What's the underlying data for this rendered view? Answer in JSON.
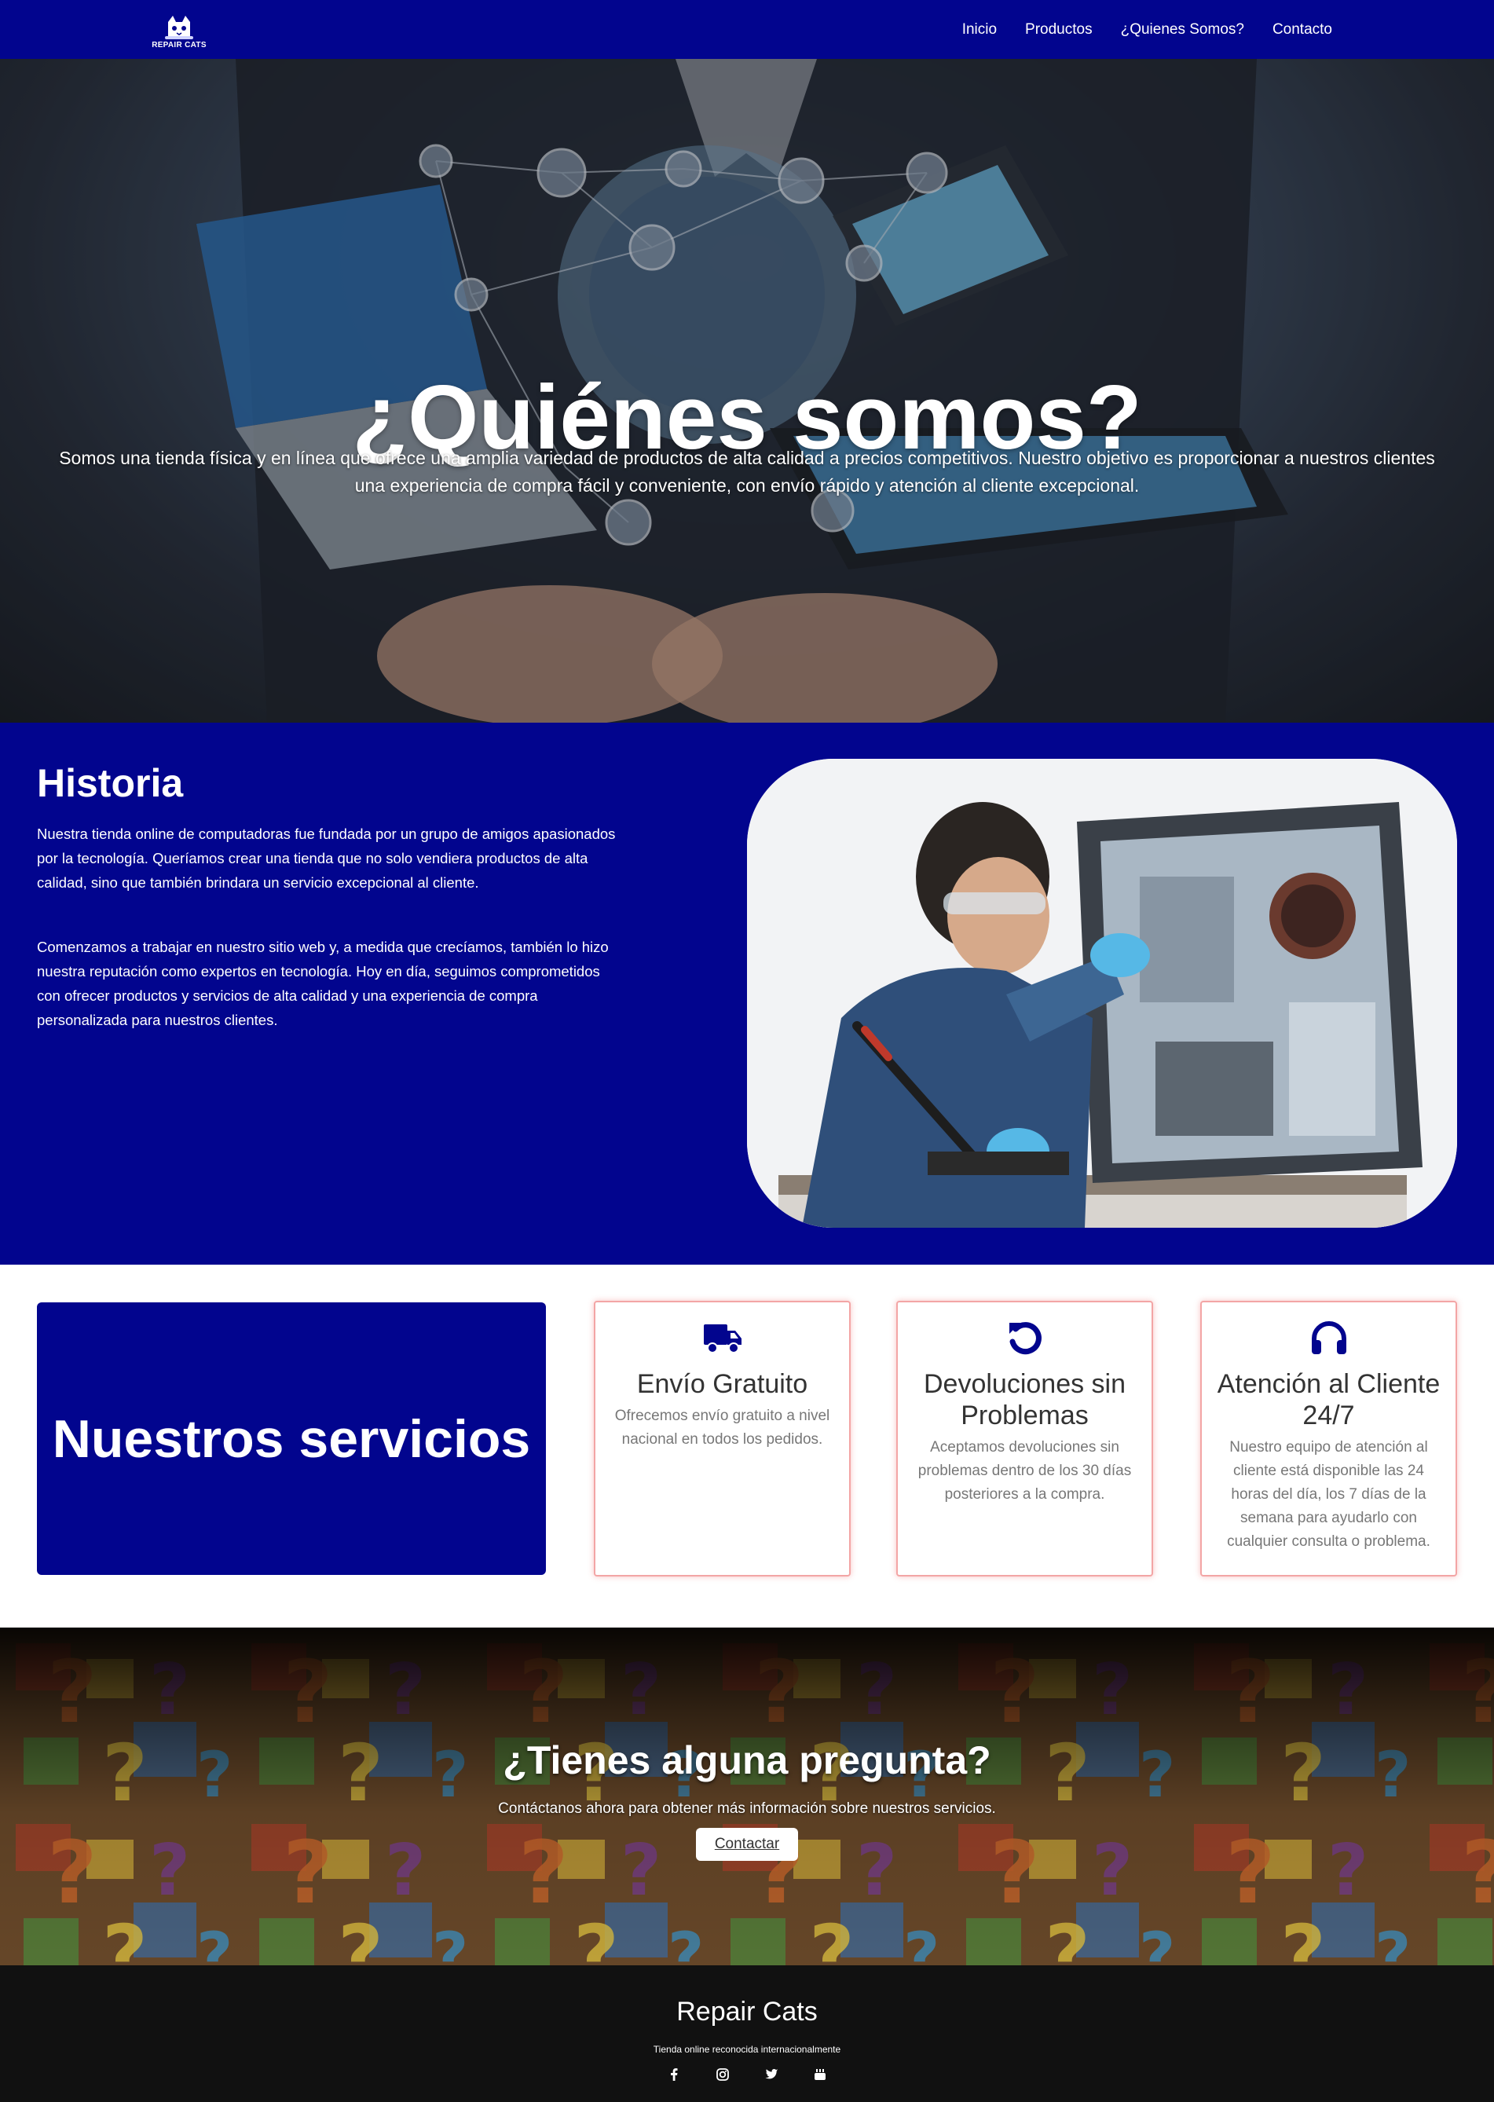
{
  "nav": {
    "logo_text": "REPAIR CATS",
    "links": [
      "Inicio",
      "Productos",
      "¿Quienes Somos?",
      "Contacto"
    ]
  },
  "hero": {
    "title": "¿Quiénes somos?",
    "text": "Somos una tienda física y en línea que ofrece una amplia variedad de productos de alta calidad a precios competitivos. Nuestro objetivo es proporcionar a nuestros clientes una experiencia de compra fácil y conveniente, con envío rápido y atención al cliente excepcional."
  },
  "historia": {
    "title": "Historia",
    "p1": "Nuestra tienda online de computadoras fue fundada por un grupo de amigos apasionados por la tecnología. Queríamos crear una tienda que no solo vendiera productos de alta calidad, sino que también brindara un servicio excepcional al cliente.",
    "p2": "Comenzamos a trabajar en nuestro sitio web y, a medida que crecíamos, también lo hizo nuestra reputación como expertos en tecnología. Hoy en día, seguimos comprometidos con ofrecer productos y servicios de alta calidad y una experiencia de compra personalizada para nuestros clientes."
  },
  "servicios": {
    "title": "Nuestros servicios",
    "cards": [
      {
        "icon": "truck-icon",
        "title": "Envío Gratuito",
        "text": "Ofrecemos envío gratuito a nivel nacional en todos los pedidos."
      },
      {
        "icon": "rotate-left-icon",
        "title": "Devoluciones sin Problemas",
        "text": "Aceptamos devoluciones sin problemas dentro de los 30 días posteriores a la compra."
      },
      {
        "icon": "headphones-icon",
        "title": "Atención al Cliente 24/7",
        "text": "Nuestro equipo de atención al cliente está disponible las 24 horas del día, los 7 días de la semana para ayudarlo con cualquier consulta o problema."
      }
    ]
  },
  "cta": {
    "title": "¿Tienes alguna pregunta?",
    "text": "Contáctanos ahora para obtener más información sobre nuestros servicios.",
    "button": "Contactar"
  },
  "footer": {
    "brand": "Repair Cats",
    "tagline": "Tienda online reconocida internacionalmente",
    "socials": [
      "facebook-icon",
      "instagram-icon",
      "twitter-icon",
      "youtube-icon"
    ]
  },
  "colors": {
    "brand_blue": "#02058e",
    "card_border": "#f3a5a5",
    "footer_bg": "#111111"
  }
}
